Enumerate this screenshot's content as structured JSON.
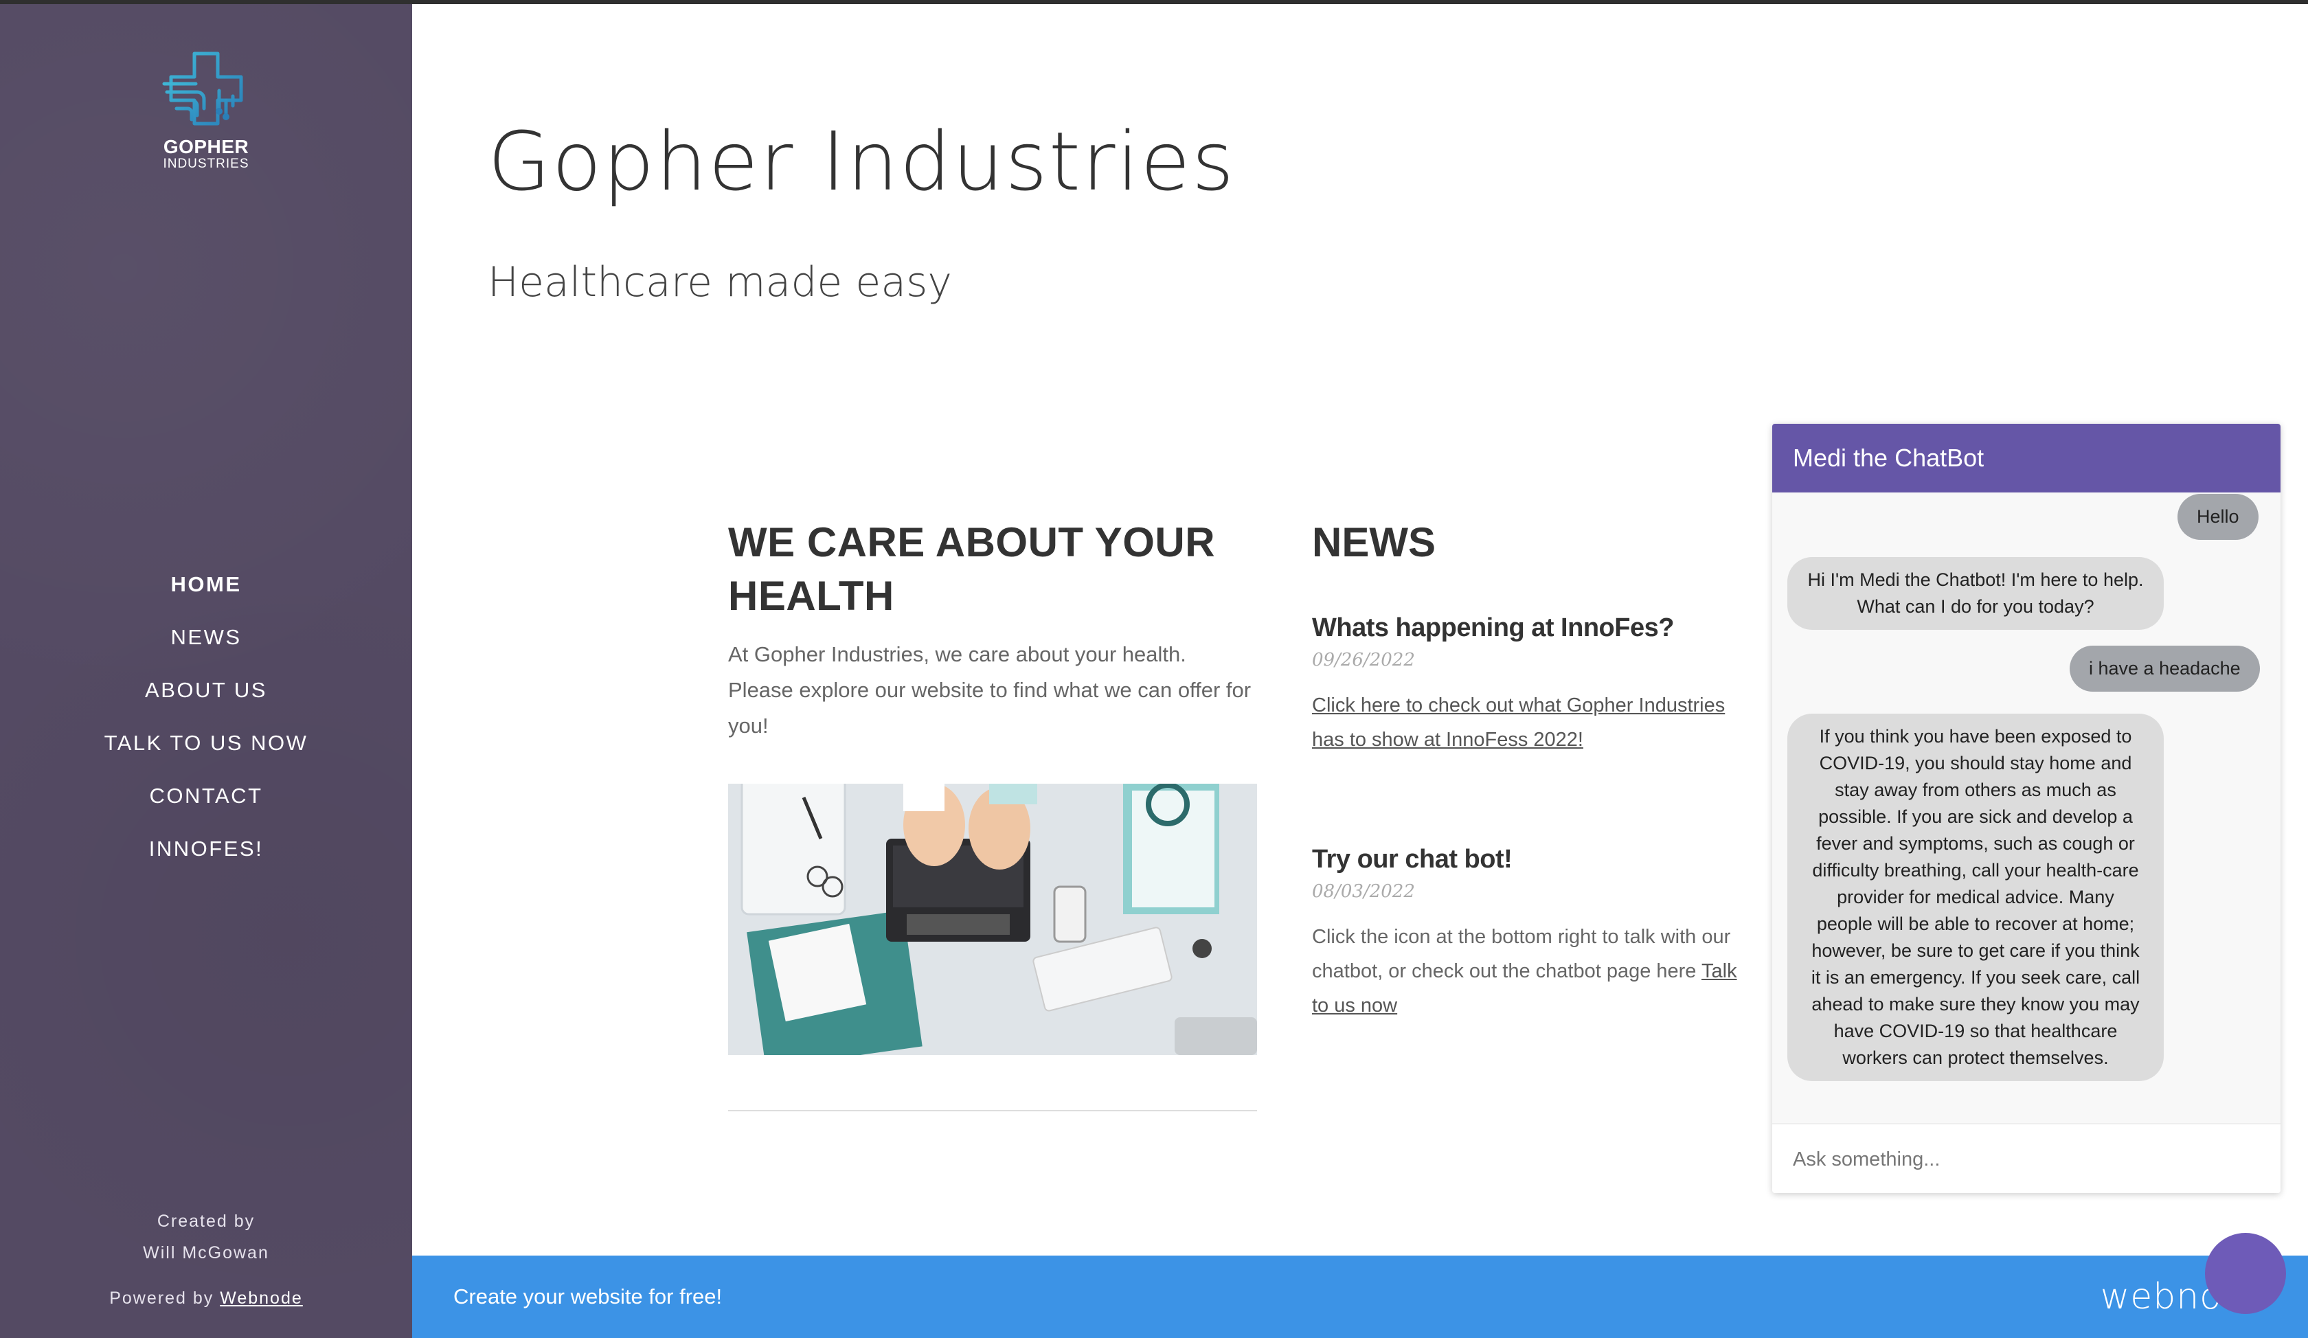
{
  "sidebar": {
    "logo_title": "GOPHER",
    "logo_subtitle": "INDUSTRIES",
    "nav": [
      "HOME",
      "NEWS",
      "ABOUT US",
      "TALK TO US NOW",
      "CONTACT",
      "INNOFES!"
    ],
    "created_by_label": "Created by",
    "creator": "Will McGowan",
    "powered_by_label": "Powered by",
    "powered_by_link": "Webnode"
  },
  "header": {
    "title": "Gopher Industries",
    "tagline": "Healthcare made easy"
  },
  "care": {
    "heading": "WE CARE ABOUT YOUR HEALTH",
    "body": "At Gopher Industries, we care about your health. Please explore our website to find what we can offer for you!"
  },
  "news": {
    "heading": "NEWS",
    "items": [
      {
        "title": "Whats happening at InnoFes?",
        "date": "09/26/2022",
        "link": "Click here to check out what Gopher Industries has to show at InnoFess 2022!"
      },
      {
        "title": "Try our chat bot!",
        "date": "08/03/2022",
        "text": "Click the icon at the bottom right to talk with our chatbot, or check out the chatbot page here",
        "link": "Talk to us now"
      }
    ]
  },
  "chat": {
    "title": "Medi the ChatBot",
    "messages": [
      {
        "from": "user",
        "text": "Hello"
      },
      {
        "from": "bot",
        "text": "Hi I'm Medi the Chatbot! I'm here to help. What can I do for you today?"
      },
      {
        "from": "user",
        "text": "i have a headache"
      },
      {
        "from": "bot",
        "text": "If you think you have been exposed to COVID-19, you should stay home and stay away from others as much as possible. If you are sick and develop a fever and symptoms, such as cough or difficulty breathing, call your health-care provider for medical advice. Many people will be able to recover at home; however, be sure to get care if you think it is an emergency. If you seek care, call ahead to make sure they know you may have COVID-19 so that healthcare workers can protect themselves."
      }
    ],
    "input_placeholder": "Ask something..."
  },
  "footer": {
    "cta": "Create your website for free!",
    "brand": "webnode"
  },
  "colors": {
    "sidebar": "#544a63",
    "chat_header": "#6556a7",
    "footer_bar": "#3c93e6"
  }
}
